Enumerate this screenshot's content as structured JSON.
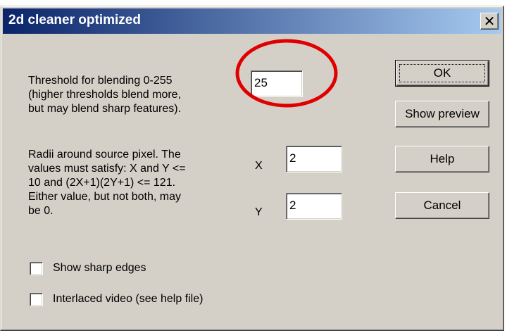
{
  "window": {
    "title": "2d cleaner optimized",
    "close_symbol": "✕"
  },
  "threshold": {
    "label_lines": [
      "Threshold for blending 0-255",
      "(higher thresholds blend more,",
      "but may blend sharp features)."
    ],
    "value": "25"
  },
  "radii": {
    "label_lines": [
      "Radii around source pixel. The",
      "values must satisfy: X and Y <=",
      "10 and (2X+1)(2Y+1) <= 121.",
      "Either value, but not both, may",
      "be 0."
    ],
    "x_label": "X",
    "x_value": "2",
    "y_label": "Y",
    "y_value": "2"
  },
  "checkboxes": {
    "sharp_edges": {
      "label": "Show sharp edges",
      "checked": false
    },
    "interlaced": {
      "label": "Interlaced video (see help file)",
      "checked": false
    }
  },
  "buttons": {
    "ok": "OK",
    "preview": "Show preview",
    "help": "Help",
    "cancel": "Cancel"
  },
  "colors": {
    "titlebar_start": "#0a246a",
    "titlebar_end": "#a6caf0",
    "dialog_face": "#d4d0c8",
    "annotation_circle": "#e00000"
  },
  "icons": {
    "close": "close-icon",
    "annotation": "red-circle-annotation"
  }
}
